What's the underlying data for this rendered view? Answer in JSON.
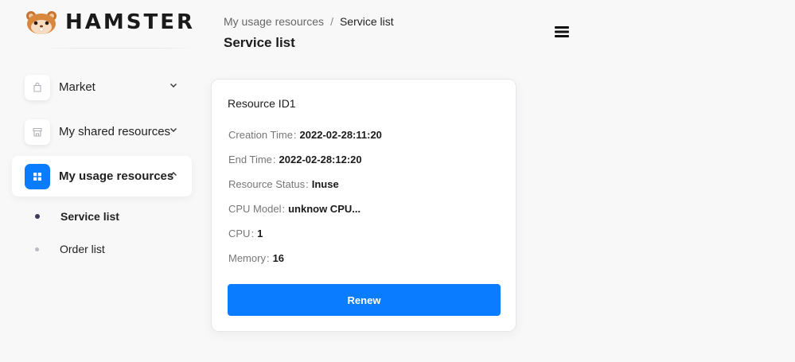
{
  "brand": {
    "name": "HAMSTER",
    "logo_icon": "hamster-icon"
  },
  "sidebar": {
    "items": [
      {
        "label": "Market",
        "icon": "bag-icon",
        "expanded": false
      },
      {
        "label": "My shared resources",
        "icon": "storefront-icon",
        "expanded": false
      },
      {
        "label": "My usage resources",
        "icon": "grid-icon",
        "expanded": true,
        "active": true
      }
    ],
    "subitems": [
      {
        "label": "Service list",
        "active": true
      },
      {
        "label": "Order list",
        "active": false
      }
    ]
  },
  "header": {
    "breadcrumb": [
      "My usage resources",
      "Service list"
    ],
    "breadcrumb_separator": "/",
    "title": "Service list",
    "menu_icon": "hamburger-menu-icon"
  },
  "card": {
    "title": "Resource ID1",
    "separator": ":",
    "fields": [
      {
        "label": "Creation Time",
        "value": "2022-02-28:11:20"
      },
      {
        "label": "End Time",
        "value": "2022-02-28:12:20"
      },
      {
        "label": "Resource Status",
        "value": "Inuse"
      },
      {
        "label": "CPU Model",
        "value": "unknow CPU..."
      },
      {
        "label": "CPU",
        "value": "1"
      },
      {
        "label": "Memory",
        "value": "16"
      }
    ],
    "button_label": "Renew"
  },
  "colors": {
    "accent": "#0a7cff",
    "background": "#f8f8f9",
    "card": "#ffffff",
    "text": "#1c1c1c",
    "muted": "#777777"
  }
}
